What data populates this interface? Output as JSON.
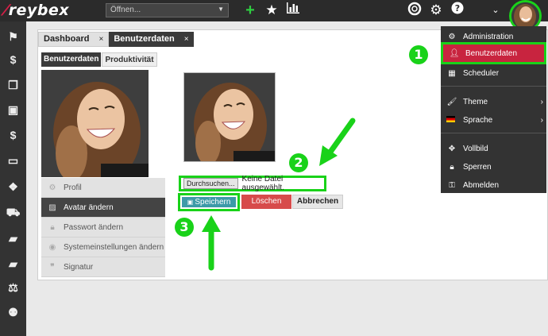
{
  "topbar": {
    "logo_text": "reybex",
    "search_select_value": "Öffnen...",
    "plus_icon": "plus-icon",
    "star_icon": "star-icon",
    "chart_icon": "bar-chart-icon",
    "help_icon": "lifebuoy-icon",
    "settings_icon": "cogs-icon",
    "question_icon": "question-circle-icon",
    "caret_icon": "caret-down-icon"
  },
  "sidebar": {
    "icons": [
      "flag-icon",
      "dollar-icon",
      "copy-icon",
      "shopping-bag-icon",
      "dollar-icon",
      "money-icon",
      "cubes-icon",
      "cart-icon",
      "book-icon",
      "book-icon",
      "balance-scale-icon",
      "user-plus-icon"
    ]
  },
  "tabs": [
    {
      "label": "Dashboard",
      "close": "×"
    },
    {
      "label": "Benutzerdaten",
      "close": "×"
    }
  ],
  "subtabs": [
    {
      "label": "Benutzerdaten"
    },
    {
      "label": "Produktivität"
    }
  ],
  "profile_menu": [
    {
      "label": "Profil",
      "icon": "gear-icon"
    },
    {
      "label": "Avatar ändern",
      "icon": "image-icon"
    },
    {
      "label": "Passwort ändern",
      "icon": "lock-icon"
    },
    {
      "label": "Systemeinstellungen ändern",
      "icon": "eye-icon"
    },
    {
      "label": "Signatur",
      "icon": "quote-icon"
    }
  ],
  "upload": {
    "browse_label": "Durchsuchen...",
    "no_file_label": "Keine Datei ausgewählt."
  },
  "actions": {
    "save_label": "Speichern",
    "delete_label": "Löschen",
    "cancel_label": "Abbrechen"
  },
  "dropdown": [
    {
      "label": "Administration",
      "icon": "gear-icon"
    },
    {
      "label": "Benutzerdaten",
      "icon": "user-icon"
    },
    {
      "label": "Scheduler",
      "icon": "calendar-icon"
    },
    {
      "label": "Theme",
      "icon": "paintbrush-icon"
    },
    {
      "label": "Sprache",
      "icon": "flag-de-icon"
    },
    {
      "label": "Vollbild",
      "icon": "arrows-icon"
    },
    {
      "label": "Sperren",
      "icon": "lock-icon"
    },
    {
      "label": "Abmelden",
      "icon": "key-icon"
    }
  ],
  "annotations": {
    "badge_1": "1",
    "badge_2": "2",
    "badge_3": "3"
  },
  "colors": {
    "accent_green": "#19d219",
    "brand_red": "#c8243f",
    "save_teal": "#3c9aa8",
    "delete_red": "#d74b4b"
  }
}
